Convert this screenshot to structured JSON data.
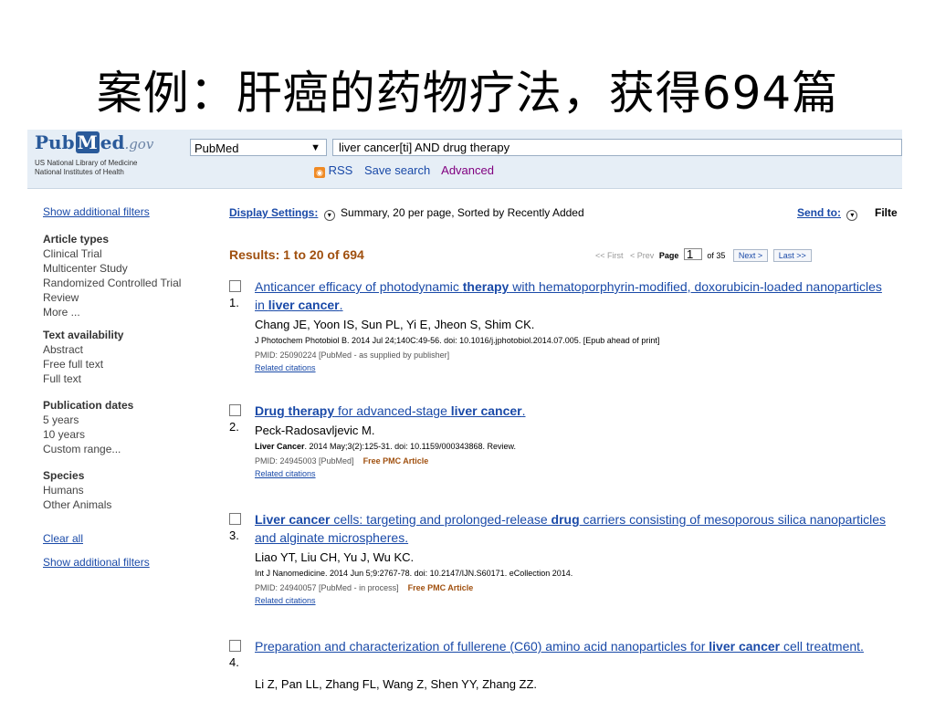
{
  "slide": {
    "title": "案例：肝癌的药物疗法，获得694篇"
  },
  "header": {
    "logo_pub": "Pub",
    "logo_m": "M",
    "logo_ed": "ed",
    "logo_gov": ".gov",
    "lib_line1": "US National Library of Medicine",
    "lib_line2": "National Institutes of Health",
    "db_select": "PubMed",
    "search_value": "liver cancer[ti] AND drug therapy",
    "rss": "RSS",
    "save_search": "Save search",
    "advanced": "Advanced"
  },
  "sidebar": {
    "show_filters_top": "Show additional filters",
    "groups": [
      {
        "title": "Article types",
        "items": [
          "Clinical Trial",
          "Multicenter Study",
          "Randomized Controlled Trial",
          "Review",
          "More ..."
        ]
      },
      {
        "title": "Text availability",
        "items": [
          "Abstract",
          "Free full text",
          "Full text"
        ]
      },
      {
        "title": "Publication dates",
        "items": [
          "5 years",
          "10 years",
          "Custom range..."
        ]
      },
      {
        "title": "Species",
        "items": [
          "Humans",
          "Other Animals"
        ]
      }
    ],
    "clear_all": "Clear all",
    "show_filters_bottom": "Show additional filters"
  },
  "display": {
    "settings_label": "Display Settings:",
    "settings_value": "Summary, 20 per page, Sorted by Recently Added",
    "send_to": "Send to:",
    "filters_cut": "Filte"
  },
  "results": {
    "header": "Results: 1 to 20 of 694",
    "pager": {
      "first": "<< First",
      "prev": "< Prev",
      "page_label": "Page",
      "page": "1",
      "of": "of 35",
      "next": "Next >",
      "last": "Last >>"
    },
    "items": [
      {
        "num": "1.",
        "title_parts": [
          {
            "t": "Anticancer efficacy of photodynamic ",
            "b": false
          },
          {
            "t": "therapy",
            "b": true
          },
          {
            "t": " with hematoporphyrin-modified, doxorubicin-loaded nanoparticles in ",
            "b": false
          },
          {
            "t": "liver cancer",
            "b": true
          },
          {
            "t": ".",
            "b": false
          }
        ],
        "authors": "Chang JE, Yoon IS, Sun PL, Yi E, Jheon S, Shim CK.",
        "journal": "J Photochem Photobiol B. 2014 Jul 24;140C:49-56. doi: 10.1016/j.jphotobiol.2014.07.005. [Epub ahead of print]",
        "journal_bold": "",
        "pmid": "PMID: 25090224 [PubMed - as supplied by publisher]",
        "free": "",
        "related": "Related citations"
      },
      {
        "num": "2.",
        "title_parts": [
          {
            "t": "Drug therapy",
            "b": true
          },
          {
            "t": " for advanced-stage ",
            "b": false
          },
          {
            "t": "liver cancer",
            "b": true
          },
          {
            "t": ".",
            "b": false
          }
        ],
        "authors": "Peck-Radosavljevic M.",
        "journal_bold": "Liver Cancer",
        "journal": ". 2014 May;3(2):125-31. doi: 10.1159/000343868. Review.",
        "pmid": "PMID: 24945003 [PubMed]",
        "free": "Free PMC Article",
        "related": "Related citations"
      },
      {
        "num": "3.",
        "title_parts": [
          {
            "t": "Liver cancer",
            "b": true
          },
          {
            "t": " cells: targeting and prolonged-release ",
            "b": false
          },
          {
            "t": "drug",
            "b": true
          },
          {
            "t": " carriers consisting of mesoporous silica nanoparticles and alginate microspheres.",
            "b": false
          }
        ],
        "authors": "Liao YT, Liu CH, Yu J, Wu KC.",
        "journal_bold": "",
        "journal": "Int J Nanomedicine. 2014 Jun 5;9:2767-78. doi: 10.2147/IJN.S60171. eCollection 2014.",
        "pmid": "PMID: 24940057 [PubMed - in process]",
        "free": "Free PMC Article",
        "related": "Related citations"
      },
      {
        "num": "4.",
        "title_parts": [
          {
            "t": "Preparation and characterization of fullerene (C60) amino acid nanoparticles for ",
            "b": false
          },
          {
            "t": "liver cancer",
            "b": true
          },
          {
            "t": " cell treatment.",
            "b": false
          }
        ],
        "authors": "Li Z, Pan LL, Zhang FL, Wang Z, Shen YY, Zhang ZZ.",
        "journal_bold": "",
        "journal": "",
        "pmid": "",
        "free": "",
        "related": ""
      }
    ]
  }
}
